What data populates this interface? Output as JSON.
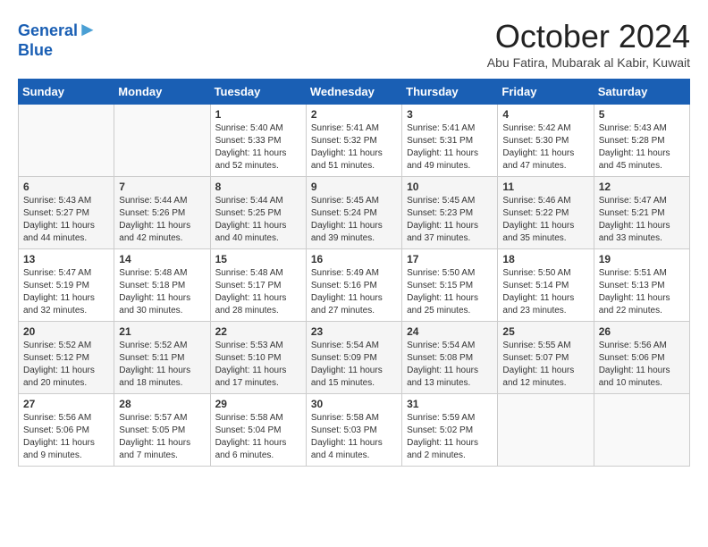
{
  "header": {
    "logo_line1": "General",
    "logo_line2": "Blue",
    "month": "October 2024",
    "location": "Abu Fatira, Mubarak al Kabir, Kuwait"
  },
  "weekdays": [
    "Sunday",
    "Monday",
    "Tuesday",
    "Wednesday",
    "Thursday",
    "Friday",
    "Saturday"
  ],
  "weeks": [
    [
      {
        "day": "",
        "info": ""
      },
      {
        "day": "",
        "info": ""
      },
      {
        "day": "1",
        "info": "Sunrise: 5:40 AM\nSunset: 5:33 PM\nDaylight: 11 hours and 52 minutes."
      },
      {
        "day": "2",
        "info": "Sunrise: 5:41 AM\nSunset: 5:32 PM\nDaylight: 11 hours and 51 minutes."
      },
      {
        "day": "3",
        "info": "Sunrise: 5:41 AM\nSunset: 5:31 PM\nDaylight: 11 hours and 49 minutes."
      },
      {
        "day": "4",
        "info": "Sunrise: 5:42 AM\nSunset: 5:30 PM\nDaylight: 11 hours and 47 minutes."
      },
      {
        "day": "5",
        "info": "Sunrise: 5:43 AM\nSunset: 5:28 PM\nDaylight: 11 hours and 45 minutes."
      }
    ],
    [
      {
        "day": "6",
        "info": "Sunrise: 5:43 AM\nSunset: 5:27 PM\nDaylight: 11 hours and 44 minutes."
      },
      {
        "day": "7",
        "info": "Sunrise: 5:44 AM\nSunset: 5:26 PM\nDaylight: 11 hours and 42 minutes."
      },
      {
        "day": "8",
        "info": "Sunrise: 5:44 AM\nSunset: 5:25 PM\nDaylight: 11 hours and 40 minutes."
      },
      {
        "day": "9",
        "info": "Sunrise: 5:45 AM\nSunset: 5:24 PM\nDaylight: 11 hours and 39 minutes."
      },
      {
        "day": "10",
        "info": "Sunrise: 5:45 AM\nSunset: 5:23 PM\nDaylight: 11 hours and 37 minutes."
      },
      {
        "day": "11",
        "info": "Sunrise: 5:46 AM\nSunset: 5:22 PM\nDaylight: 11 hours and 35 minutes."
      },
      {
        "day": "12",
        "info": "Sunrise: 5:47 AM\nSunset: 5:21 PM\nDaylight: 11 hours and 33 minutes."
      }
    ],
    [
      {
        "day": "13",
        "info": "Sunrise: 5:47 AM\nSunset: 5:19 PM\nDaylight: 11 hours and 32 minutes."
      },
      {
        "day": "14",
        "info": "Sunrise: 5:48 AM\nSunset: 5:18 PM\nDaylight: 11 hours and 30 minutes."
      },
      {
        "day": "15",
        "info": "Sunrise: 5:48 AM\nSunset: 5:17 PM\nDaylight: 11 hours and 28 minutes."
      },
      {
        "day": "16",
        "info": "Sunrise: 5:49 AM\nSunset: 5:16 PM\nDaylight: 11 hours and 27 minutes."
      },
      {
        "day": "17",
        "info": "Sunrise: 5:50 AM\nSunset: 5:15 PM\nDaylight: 11 hours and 25 minutes."
      },
      {
        "day": "18",
        "info": "Sunrise: 5:50 AM\nSunset: 5:14 PM\nDaylight: 11 hours and 23 minutes."
      },
      {
        "day": "19",
        "info": "Sunrise: 5:51 AM\nSunset: 5:13 PM\nDaylight: 11 hours and 22 minutes."
      }
    ],
    [
      {
        "day": "20",
        "info": "Sunrise: 5:52 AM\nSunset: 5:12 PM\nDaylight: 11 hours and 20 minutes."
      },
      {
        "day": "21",
        "info": "Sunrise: 5:52 AM\nSunset: 5:11 PM\nDaylight: 11 hours and 18 minutes."
      },
      {
        "day": "22",
        "info": "Sunrise: 5:53 AM\nSunset: 5:10 PM\nDaylight: 11 hours and 17 minutes."
      },
      {
        "day": "23",
        "info": "Sunrise: 5:54 AM\nSunset: 5:09 PM\nDaylight: 11 hours and 15 minutes."
      },
      {
        "day": "24",
        "info": "Sunrise: 5:54 AM\nSunset: 5:08 PM\nDaylight: 11 hours and 13 minutes."
      },
      {
        "day": "25",
        "info": "Sunrise: 5:55 AM\nSunset: 5:07 PM\nDaylight: 11 hours and 12 minutes."
      },
      {
        "day": "26",
        "info": "Sunrise: 5:56 AM\nSunset: 5:06 PM\nDaylight: 11 hours and 10 minutes."
      }
    ],
    [
      {
        "day": "27",
        "info": "Sunrise: 5:56 AM\nSunset: 5:06 PM\nDaylight: 11 hours and 9 minutes."
      },
      {
        "day": "28",
        "info": "Sunrise: 5:57 AM\nSunset: 5:05 PM\nDaylight: 11 hours and 7 minutes."
      },
      {
        "day": "29",
        "info": "Sunrise: 5:58 AM\nSunset: 5:04 PM\nDaylight: 11 hours and 6 minutes."
      },
      {
        "day": "30",
        "info": "Sunrise: 5:58 AM\nSunset: 5:03 PM\nDaylight: 11 hours and 4 minutes."
      },
      {
        "day": "31",
        "info": "Sunrise: 5:59 AM\nSunset: 5:02 PM\nDaylight: 11 hours and 2 minutes."
      },
      {
        "day": "",
        "info": ""
      },
      {
        "day": "",
        "info": ""
      }
    ]
  ]
}
